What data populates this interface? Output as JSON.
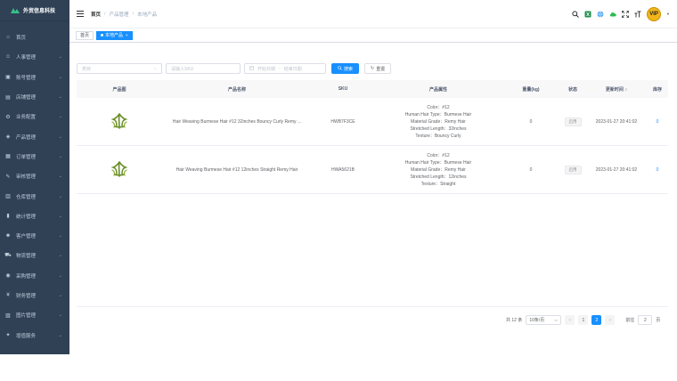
{
  "sidebar": {
    "brand_title": "外贸信息科技",
    "items": [
      {
        "label": "首页",
        "icon": "home-icon",
        "has_children": false
      },
      {
        "label": "人事管理",
        "icon": "user-group-icon",
        "has_children": true
      },
      {
        "label": "账号管理",
        "icon": "account-icon",
        "has_children": true
      },
      {
        "label": "店铺管理",
        "icon": "shop-icon",
        "has_children": true
      },
      {
        "label": "业务配置",
        "icon": "config-icon",
        "has_children": true
      },
      {
        "label": "产品管理",
        "icon": "product-icon",
        "has_children": true
      },
      {
        "label": "订单管理",
        "icon": "order-icon",
        "has_children": true
      },
      {
        "label": "审核管理",
        "icon": "audit-icon",
        "has_children": true
      },
      {
        "label": "仓库管理",
        "icon": "warehouse-icon",
        "has_children": true
      },
      {
        "label": "统计管理",
        "icon": "chart-icon",
        "has_children": true
      },
      {
        "label": "客户管理",
        "icon": "customer-icon",
        "has_children": true
      },
      {
        "label": "物流管理",
        "icon": "logistics-icon",
        "has_children": true
      },
      {
        "label": "采购管理",
        "icon": "purchase-icon",
        "has_children": true
      },
      {
        "label": "财务管理",
        "icon": "finance-icon",
        "has_children": true
      },
      {
        "label": "图片管理",
        "icon": "image-icon",
        "has_children": true
      },
      {
        "label": "增值服务",
        "icon": "service-icon",
        "has_children": true
      }
    ]
  },
  "header": {
    "breadcrumb": [
      "首页",
      "产品管理",
      "本地产品"
    ],
    "avatar_text": "VIP"
  },
  "tags": [
    {
      "label": "首页",
      "active": false
    },
    {
      "label": "本地产品",
      "active": true
    }
  ],
  "filters": {
    "select_placeholder": "类目",
    "sku_placeholder": "请输入SKU",
    "date_start_placeholder": "开始日期",
    "date_sep": "-",
    "date_end_placeholder": "结束日期",
    "search_label": "搜索",
    "reset_label": "重置"
  },
  "table": {
    "columns": [
      "产品图",
      "产品名称",
      "SKU",
      "产品属性",
      "重量(kg)",
      "状态",
      "更新时间",
      "库存"
    ],
    "rows": [
      {
        "name": "Hair Weaving Burmese Hair #12 32inches Bouncy Curly Remy ...",
        "sku": "HWB7F3CE",
        "attributes": [
          "Color：#12",
          "Human Hair Type：Burmese Hair",
          "Material Grade：Remy Hair",
          "Stretched Length：32inches",
          "Texture：Bouncy Curly"
        ],
        "weight": "0",
        "status": "启用",
        "updated": "2023-01-27 20:41:02",
        "stock": "0"
      },
      {
        "name": "Hair Weaving Burmese Hair #12 12inches Straight Remy Hair",
        "sku": "HWA5621B",
        "attributes": [
          "Color：#12",
          "Human Hair Type：Burmese Hair",
          "Material Grade：Remy Hair",
          "Stretched Length：12inches",
          "Texture：Straight"
        ],
        "weight": "0",
        "status": "启用",
        "updated": "2023-01-27 20:41:02",
        "stock": "0"
      }
    ]
  },
  "pagination": {
    "total_text": "共 12 条",
    "page_size": "10条/页",
    "prev": "<",
    "pages": [
      "1",
      "2"
    ],
    "current": "2",
    "next": ">",
    "goto_label": "前往",
    "goto_value": "2",
    "goto_suffix": "页"
  },
  "colors": {
    "sidebar_bg": "#304156",
    "accent": "#1890ff",
    "avatar": "#f1b51c"
  }
}
